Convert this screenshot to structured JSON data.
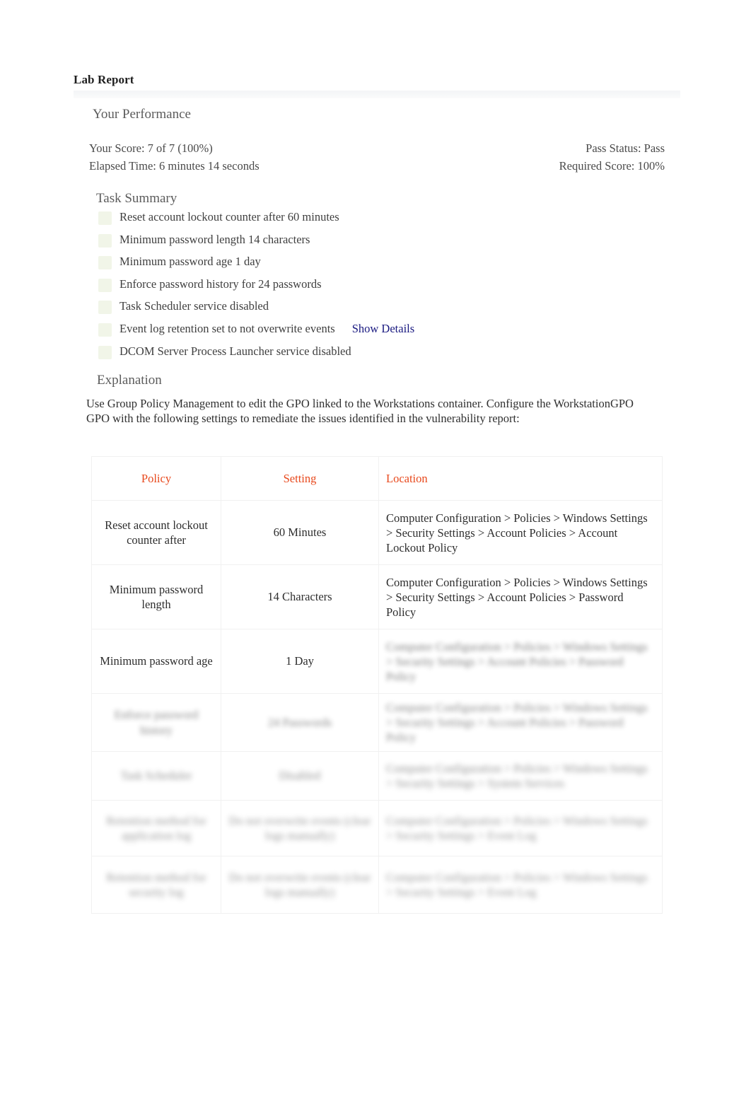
{
  "document": {
    "title": "Lab Report"
  },
  "performance": {
    "heading": "Your Performance",
    "score_label": "Your Score: 7 of 7 (100%)",
    "elapsed_label": "Elapsed Time: 6 minutes 14 seconds",
    "pass_status_label": "Pass Status: Pass",
    "required_score_label": "Required Score: 100%"
  },
  "task_summary": {
    "heading": "Task Summary",
    "items": [
      {
        "label": "Reset account lockout counter after 60 minutes",
        "status_icon": "check-square-icon",
        "link": null
      },
      {
        "label": "Minimum password length 14 characters",
        "status_icon": "check-square-icon",
        "link": null
      },
      {
        "label": "Minimum password age 1 day",
        "status_icon": "check-square-icon",
        "link": null
      },
      {
        "label": "Enforce password history for 24 passwords",
        "status_icon": "check-square-icon",
        "link": null
      },
      {
        "label": "Task Scheduler service disabled",
        "status_icon": "check-square-icon",
        "link": null
      },
      {
        "label": "Event log retention set to not overwrite events",
        "status_icon": "check-square-icon",
        "link": "Show Details"
      },
      {
        "label": "DCOM Server Process Launcher service disabled",
        "status_icon": "check-square-icon",
        "link": null
      }
    ]
  },
  "explanation": {
    "heading": "Explanation",
    "body": "Use Group Policy Management to edit the GPO linked to the Workstations container. Configure the WorkstationGPO   GPO with the following settings to remediate the issues identified in the vulnerability report:"
  },
  "policy_table": {
    "columns": [
      "Policy",
      "Setting",
      "Location"
    ],
    "rows": [
      {
        "policy": "Reset account lockout counter after",
        "setting": "60 Minutes",
        "location": "Computer Configuration > Policies > Windows Settings > Security Settings > Account Policies > Account Lockout Policy",
        "legibility": "clear"
      },
      {
        "policy": "Minimum password length",
        "setting": "14 Characters",
        "location": "Computer Configuration > Policies > Windows Settings > Security Settings > Account Policies > Password Policy",
        "legibility": "clear"
      },
      {
        "policy": "Minimum password age",
        "setting": "1 Day",
        "location": "Computer Configuration > Policies > Windows Settings > Security Settings > Account Policies > Password Policy",
        "legibility": "location-blurred"
      },
      {
        "policy": "Enforce password history",
        "setting": "24 Passwords",
        "location": "Computer Configuration > Policies > Windows Settings > Security Settings > Account Policies > Password Policy",
        "legibility": "blurred"
      },
      {
        "policy": "Task Scheduler",
        "setting": "Disabled",
        "location": "Computer Configuration > Policies > Windows Settings > Security Settings > System Services",
        "legibility": "blurred"
      },
      {
        "policy": "Retention method for application log",
        "setting": "Do not overwrite events (clear logs manually)",
        "location": "Computer Configuration > Policies > Windows Settings > Security Settings > Event Log",
        "legibility": "blurred"
      },
      {
        "policy": "Retention method for security log",
        "setting": "Do not overwrite events (clear logs manually)",
        "location": "Computer Configuration > Policies > Windows Settings > Security Settings > Event Log",
        "legibility": "blurred"
      }
    ]
  },
  "colors": {
    "table_header_accent": "#e8491d",
    "link": "#191980",
    "status_icon": "#f1f5e8",
    "body_text": "#3a3a3a",
    "heading_text": "#5c5c5c"
  }
}
